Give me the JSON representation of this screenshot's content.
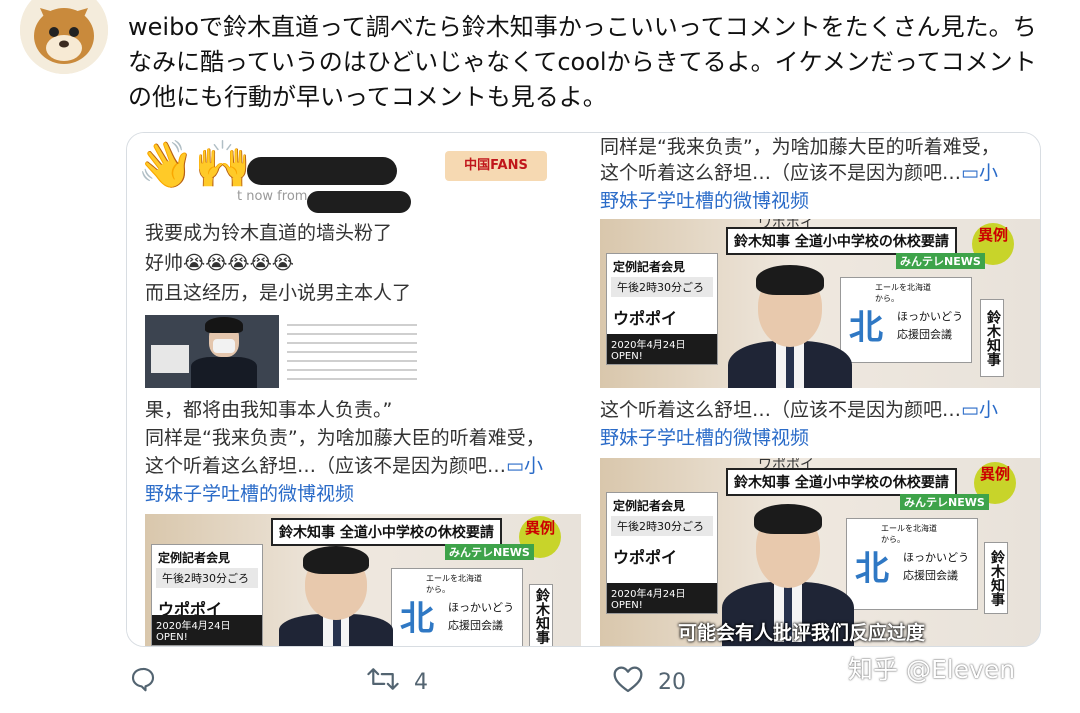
{
  "tweet": {
    "text": "weiboで鈴木直道って調べたら鈴木知事かっこいいってコメントをたくさん見た。ちなみに酷っていうのはひどいじゃなくてcoolからきてるよ。イケメンだってコメントの他にも行動が早いってコメントも見るよ。"
  },
  "screenshot1": {
    "timestamp_fragment": "t now  from",
    "badge": "中国FANS",
    "line1": "我要成为铃木直道的墙头粉了",
    "line2": "好帅😭😭😭😭😭",
    "line3": "而且这经历，是小说男主本人了"
  },
  "screenshot2": {
    "line1": "同样是“我来负责”，为啥加藤大臣的听着难受，",
    "line2_text": "这个听着这么舒坦…（应该不是因为颜吧…",
    "line2_link": "▭小",
    "line3_link": "野妹子学吐槽的微博视频"
  },
  "screenshot3": {
    "line1": "果，都将由我知事本人负责。”",
    "line2": "同样是“我来负责”，为啥加藤大臣的听着难受，",
    "line3_text": "这个听着这么舒坦…（应该不是因为颜吧…",
    "line3_link": "▭小",
    "line4_link": "野妹子学吐槽的微博视频"
  },
  "screenshot4": {
    "line1_text": "这个听着这么舒坦…（应该不是因为颜吧…",
    "line1_link": "▭小",
    "line2_link": "野妹子学吐槽的微博视频",
    "subtitle": "可能会有人批评我们反应过度"
  },
  "video": {
    "top_fragment": "ワポポイ",
    "headline_name": "鈴木知事",
    "headline_text": "全道小中学校の休校要請",
    "ireii": "異例",
    "news_badge": "みんテレNEWS",
    "sign_title": "定例記者会見",
    "sign_time": "午後2時30分ごろ",
    "sign_logo": "ウポポイ",
    "sign_open": "2020年4月24日OPEN!",
    "poster_small": "エールを北海道から。",
    "poster_hokkaido": "ほっかいどう",
    "poster_team": "応援団会議",
    "nameplate": "鈴木知事"
  },
  "actions": {
    "retweet_count": "4",
    "like_count": "20"
  },
  "watermark": "知乎 @Eleven"
}
